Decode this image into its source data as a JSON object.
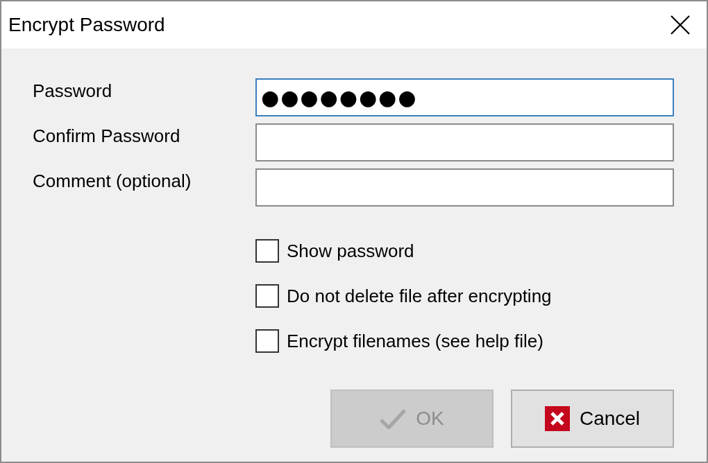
{
  "window": {
    "title": "Encrypt Password"
  },
  "fields": [
    {
      "label": "Password",
      "value": "●●●●●●●●",
      "focused": true
    },
    {
      "label": "Confirm Password",
      "focused": false
    },
    {
      "label": "Comment (optional)",
      "focused": false
    }
  ],
  "options": [
    {
      "label": "Show password",
      "checked": false
    },
    {
      "label": "Do not delete file after encrypting",
      "checked": false
    },
    {
      "label": "Encrypt filenames (see help file)",
      "checked": false
    }
  ],
  "buttons": [
    {
      "label": "OK",
      "kind": "ok",
      "disabled": true
    },
    {
      "label": "Cancel",
      "kind": "cancel",
      "disabled": false
    }
  ]
}
